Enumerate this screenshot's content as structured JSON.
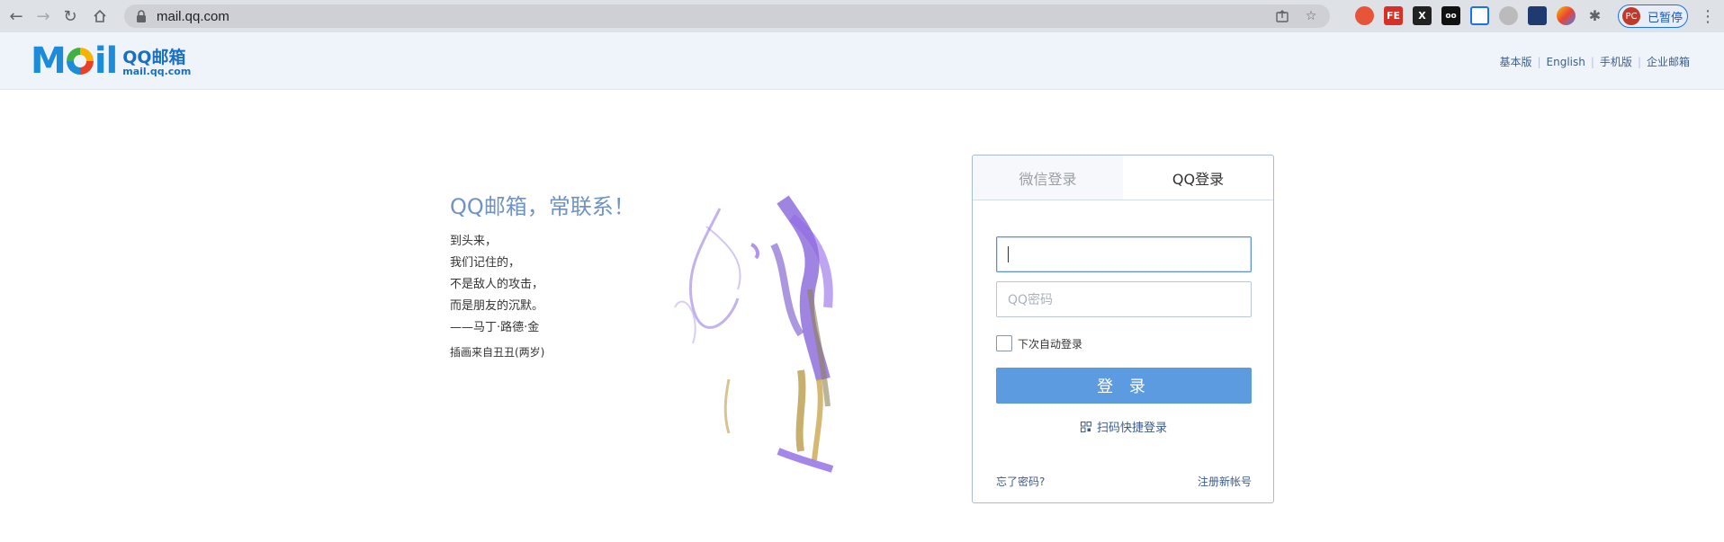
{
  "browser": {
    "url": "mail.qq.com",
    "profile_initials": "PC",
    "profile_label": "已暂停",
    "icons": [
      "back-icon",
      "forward-icon",
      "reload-icon",
      "home-icon",
      "lock-icon",
      "share-icon",
      "star-icon",
      "extensions-icon",
      "menu-icon"
    ]
  },
  "header": {
    "logo_main": "QQ邮箱",
    "logo_sub": "mail.qq.com",
    "links": [
      "基本版",
      "English",
      "手机版",
      "企业邮箱"
    ],
    "brand_color": "#1c8bd8"
  },
  "promo": {
    "title": "QQ邮箱，常联系！",
    "poem": [
      "到头来，",
      "我们记住的，",
      "不是敌人的攻击，",
      "而是朋友的沉默。",
      "——马丁·路德·金"
    ],
    "credit": "插画来自丑丑(两岁)"
  },
  "login": {
    "tabs": [
      "微信登录",
      "QQ登录"
    ],
    "active_tab": "QQ登录",
    "account_value": "",
    "password_placeholder": "QQ密码",
    "remember_label": "下次自动登录",
    "submit_label": "登 录",
    "qr_label": "扫码快捷登录",
    "forgot_label": "忘了密码?",
    "register_label": "注册新帐号",
    "accent_color": "#5c9be0"
  }
}
